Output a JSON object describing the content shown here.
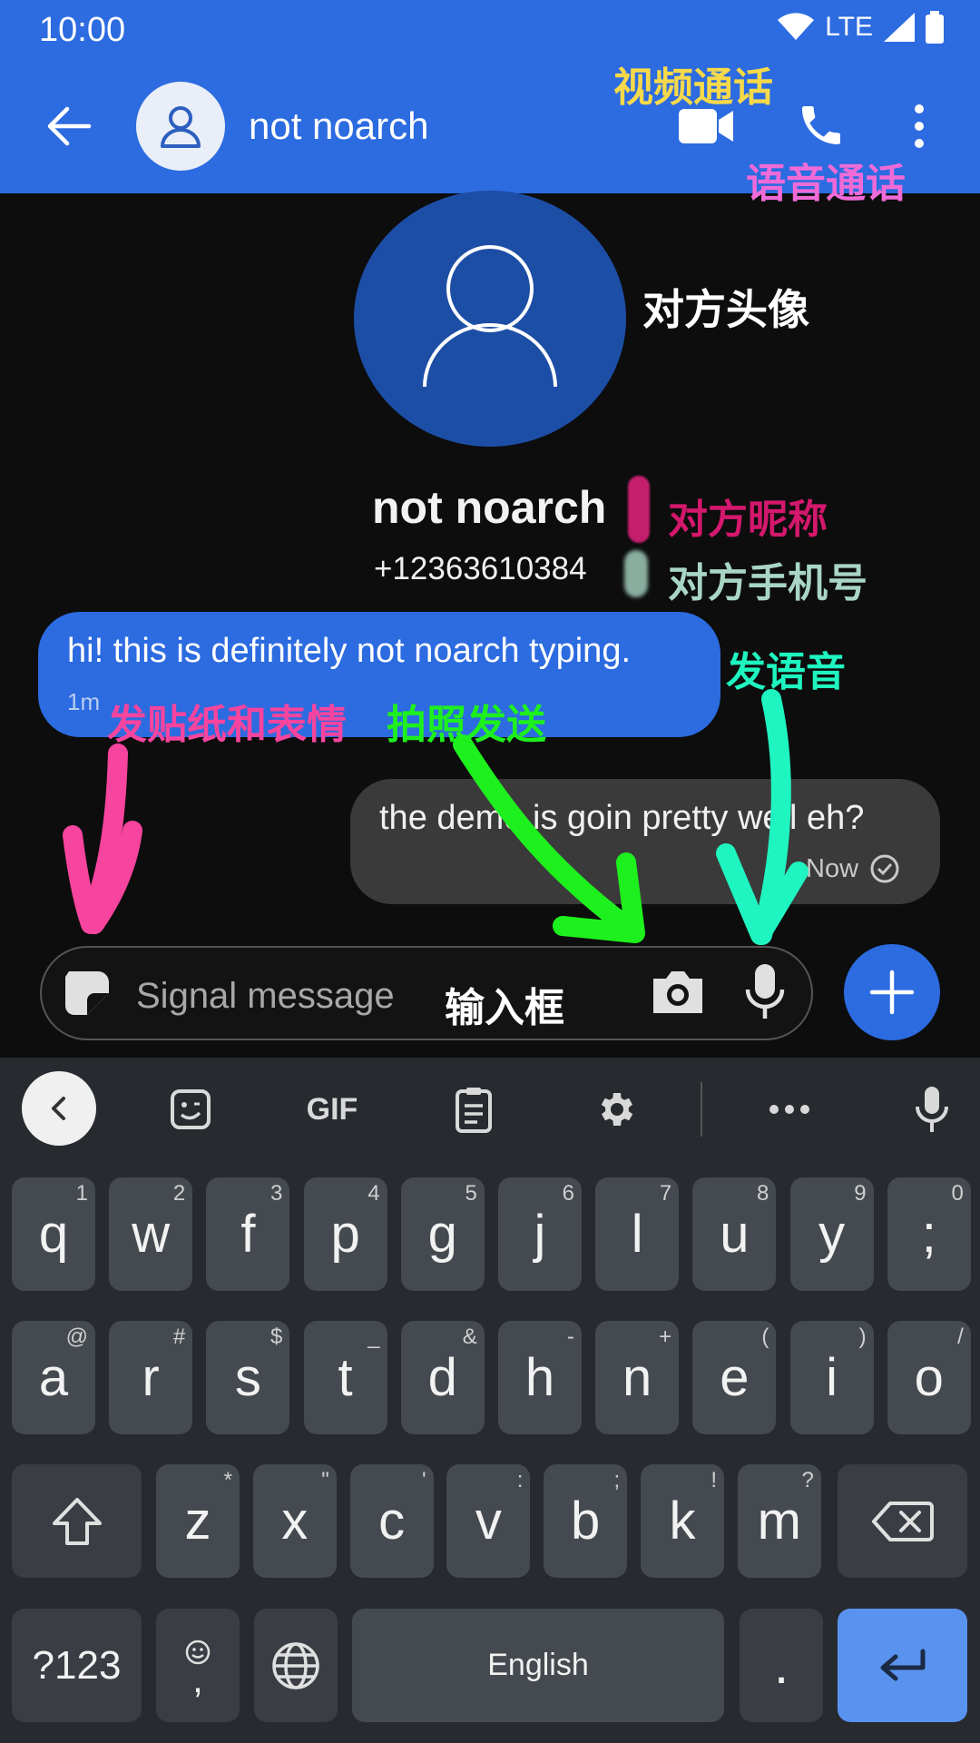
{
  "status": {
    "time": "10:00",
    "network": "LTE"
  },
  "header": {
    "contact_name": "not noarch"
  },
  "contact_card": {
    "name": "not noarch",
    "phone": "+12363610384"
  },
  "messages": {
    "incoming": {
      "text": "hi! this is definitely not noarch typing.",
      "time": "1m"
    },
    "outgoing": {
      "text": "the demo is goin pretty well eh?",
      "time": "Now"
    }
  },
  "composer": {
    "placeholder": "Signal message"
  },
  "annotations": {
    "video_call": "视频通话",
    "voice_call": "语音通话",
    "avatar": "对方头像",
    "nickname": "对方昵称",
    "phone": "对方手机号",
    "voice_msg": "发语音",
    "sticker": "发贴纸和表情",
    "photo": "拍照发送",
    "input_box": "输入框"
  },
  "keyboard": {
    "toolbar": {
      "gif": "GIF"
    },
    "row1": [
      {
        "k": "q",
        "h": "1"
      },
      {
        "k": "w",
        "h": "2"
      },
      {
        "k": "f",
        "h": "3"
      },
      {
        "k": "p",
        "h": "4"
      },
      {
        "k": "g",
        "h": "5"
      },
      {
        "k": "j",
        "h": "6"
      },
      {
        "k": "l",
        "h": "7"
      },
      {
        "k": "u",
        "h": "8"
      },
      {
        "k": "y",
        "h": "9"
      },
      {
        "k": ";",
        "h": "0"
      }
    ],
    "row2": [
      {
        "k": "a",
        "h": "@"
      },
      {
        "k": "r",
        "h": "#"
      },
      {
        "k": "s",
        "h": "$"
      },
      {
        "k": "t",
        "h": "_"
      },
      {
        "k": "d",
        "h": "&"
      },
      {
        "k": "h",
        "h": "-"
      },
      {
        "k": "n",
        "h": "+"
      },
      {
        "k": "e",
        "h": "("
      },
      {
        "k": "i",
        "h": ")"
      },
      {
        "k": "o",
        "h": "/"
      }
    ],
    "row3": [
      {
        "k": "z",
        "h": "*"
      },
      {
        "k": "x",
        "h": "\""
      },
      {
        "k": "c",
        "h": "'"
      },
      {
        "k": "v",
        "h": ":"
      },
      {
        "k": "b",
        "h": ";"
      },
      {
        "k": "k",
        "h": "!"
      },
      {
        "k": "m",
        "h": "?"
      }
    ],
    "symbols_label": "?123",
    "comma": ",",
    "space_label": "English",
    "period": "."
  },
  "colors": {
    "accent": "#2c6be0",
    "annot_yellow": "#f7d94a",
    "annot_pink": "#f06bd8",
    "annot_magenta": "#d4186d",
    "annot_teal": "#a9d6c4",
    "annot_cyan": "#1ff5c0",
    "annot_green": "#1ef01e",
    "annot_hotpink": "#f7449e"
  }
}
